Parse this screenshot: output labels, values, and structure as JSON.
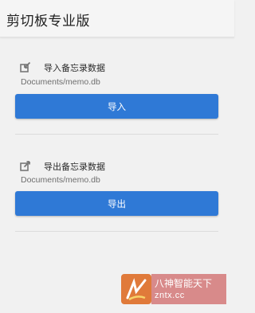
{
  "app": {
    "title": "剪切板专业版"
  },
  "import_section": {
    "title": "导入备忘录数据",
    "path": "Documents/memo.db",
    "button_label": "导入"
  },
  "export_section": {
    "title": "导出备忘录数据",
    "path": "Documents/memo.db",
    "button_label": "导出"
  },
  "watermark": {
    "name": "八神智能天下",
    "url": "zntx.cc"
  },
  "colors": {
    "accent": "#2f79d6",
    "background": "#f1f1f1"
  },
  "icons": {
    "import": "import-icon",
    "export": "export-icon"
  }
}
